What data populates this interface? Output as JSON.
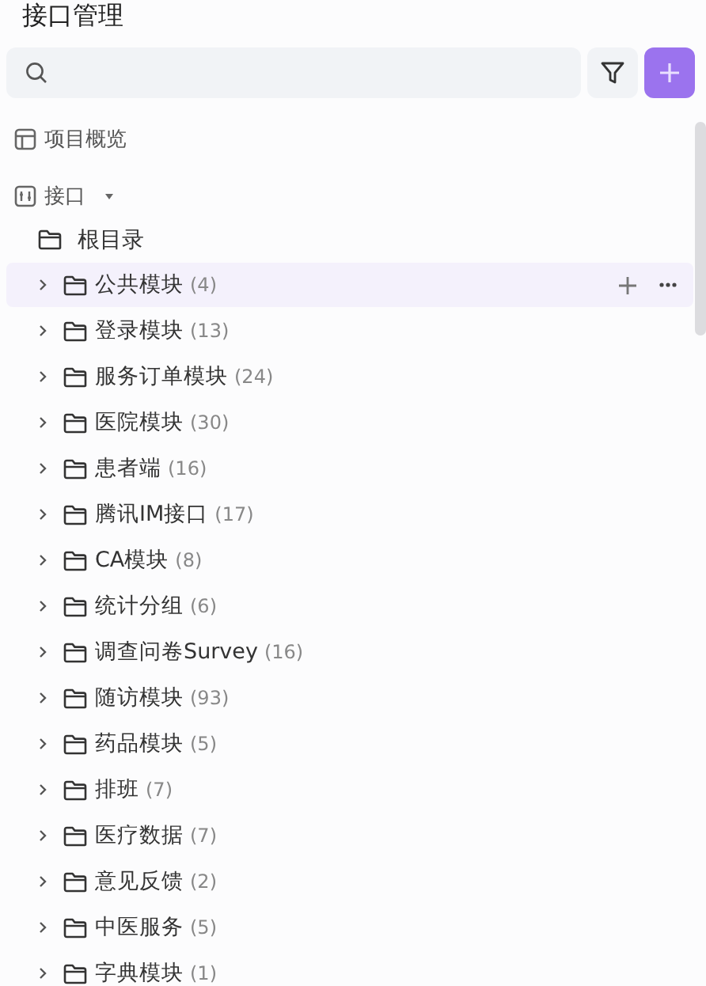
{
  "title": "接口管理",
  "nav": [
    {
      "kind": "overview",
      "label": "项目概览",
      "expanded": false
    },
    {
      "kind": "api",
      "label": "接口",
      "expanded": true
    }
  ],
  "tree": {
    "label": "根目录",
    "children": [
      {
        "label": "公共模块",
        "count": "(4)",
        "selected": true
      },
      {
        "label": "登录模块",
        "count": "(13)",
        "selected": false
      },
      {
        "label": "服务订单模块",
        "count": "(24)",
        "selected": false
      },
      {
        "label": "医院模块",
        "count": "(30)",
        "selected": false
      },
      {
        "label": "患者端",
        "count": "(16)",
        "selected": false
      },
      {
        "label": "腾讯IM接口",
        "count": "(17)",
        "selected": false
      },
      {
        "label": "CA模块",
        "count": "(8)",
        "selected": false
      },
      {
        "label": "统计分组",
        "count": "(6)",
        "selected": false
      },
      {
        "label": "调查问卷Survey",
        "count": "(16)",
        "selected": false
      },
      {
        "label": "随访模块",
        "count": "(93)",
        "selected": false
      },
      {
        "label": "药品模块",
        "count": "(5)",
        "selected": false
      },
      {
        "label": "排班",
        "count": "(7)",
        "selected": false
      },
      {
        "label": "医疗数据",
        "count": "(7)",
        "selected": false
      },
      {
        "label": "意见反馈",
        "count": "(2)",
        "selected": false
      },
      {
        "label": "中医服务",
        "count": "(5)",
        "selected": false
      },
      {
        "label": "字典模块",
        "count": "(1)",
        "selected": false
      }
    ]
  }
}
